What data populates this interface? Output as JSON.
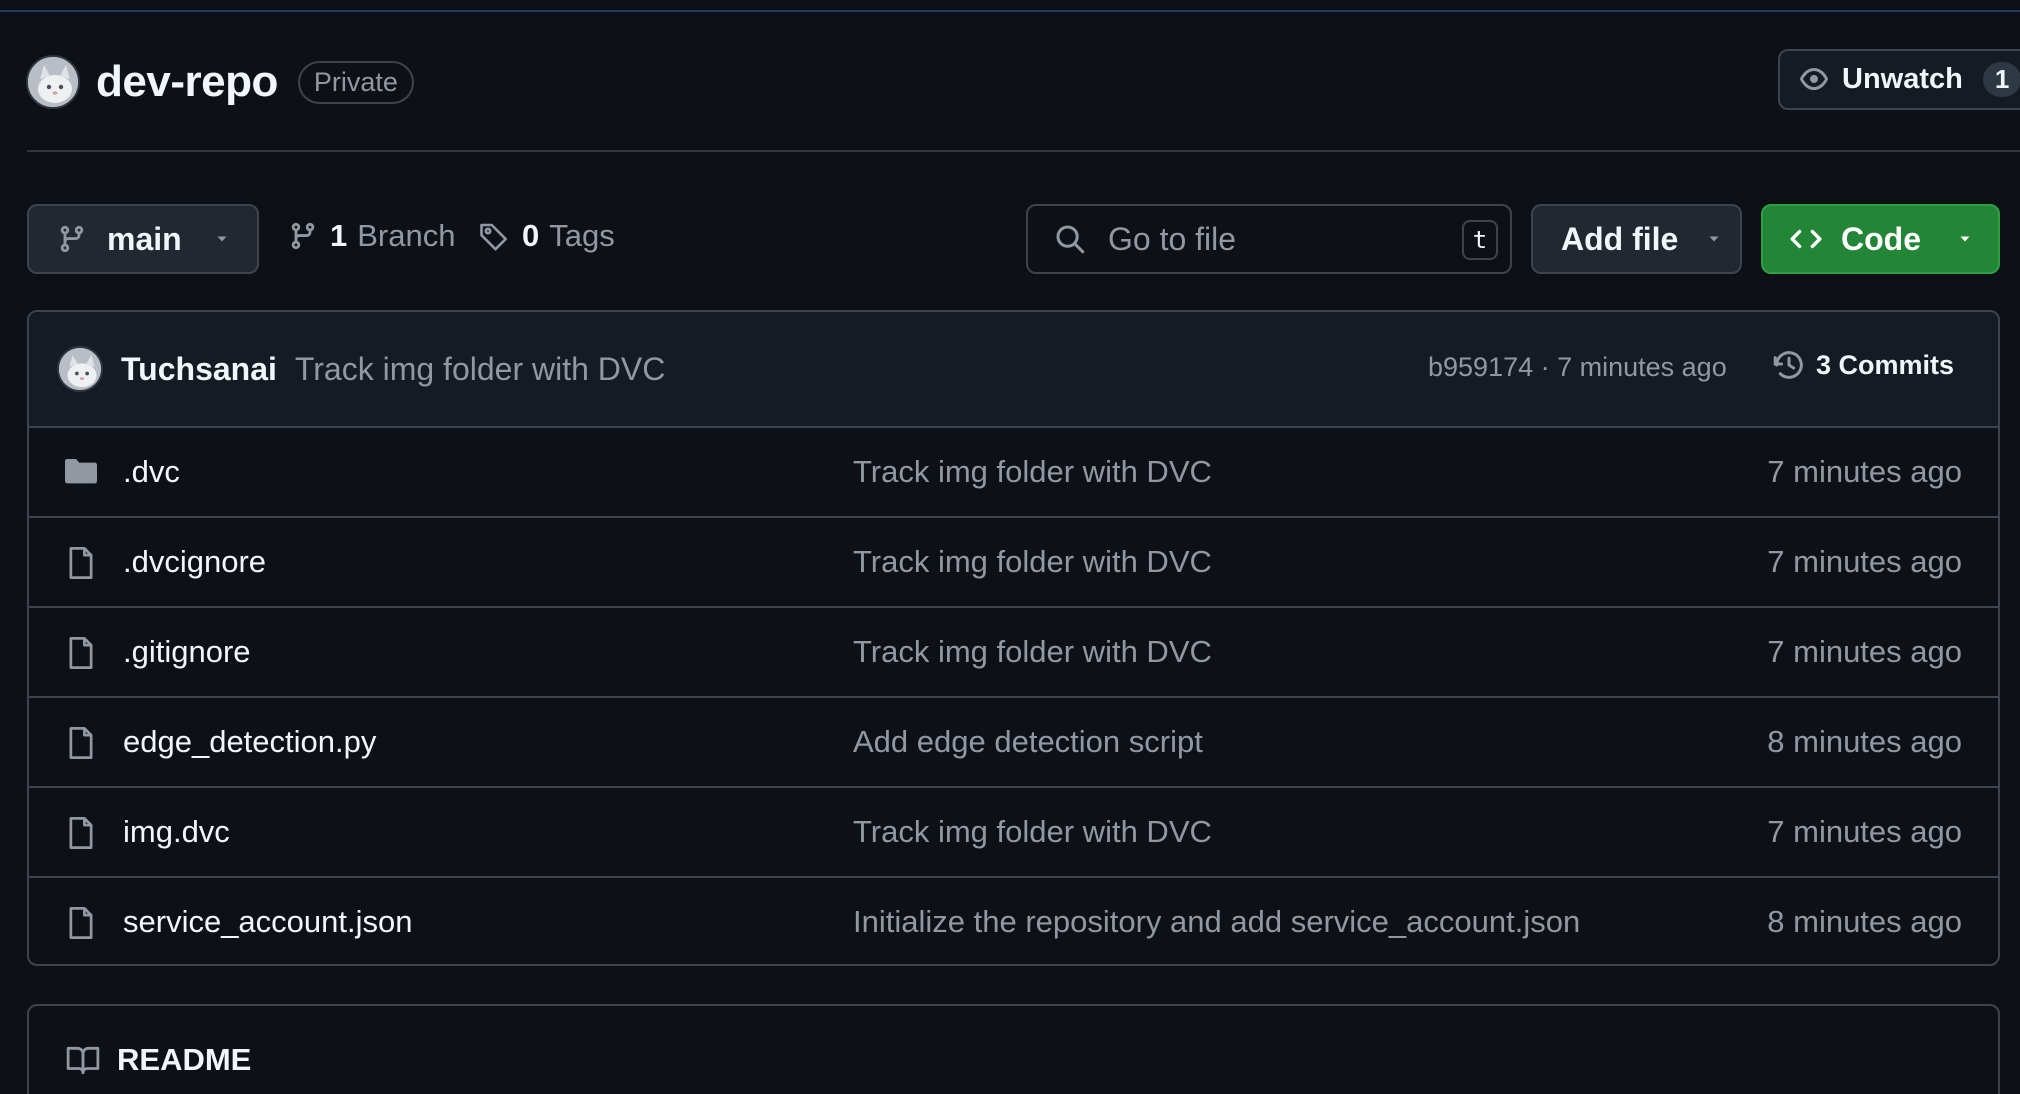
{
  "repo": {
    "name": "dev-repo",
    "visibility": "Private"
  },
  "watch": {
    "label": "Unwatch",
    "count": "1"
  },
  "toolbar": {
    "branch": "main",
    "branch_count": "1",
    "branch_label": "Branch",
    "tag_count": "0",
    "tag_label": "Tags",
    "search_placeholder": "Go to file",
    "search_shortcut": "t",
    "add_file_label": "Add file",
    "code_label": "Code"
  },
  "latest_commit": {
    "author": "Tuchsanai",
    "message": "Track img folder with DVC",
    "meta": "b959174 · 7 minutes ago",
    "commits_label": "3 Commits"
  },
  "files": [
    {
      "name": ".dvc",
      "type": "folder",
      "message": "Track img folder with DVC",
      "time": "7 minutes ago"
    },
    {
      "name": ".dvcignore",
      "type": "file",
      "message": "Track img folder with DVC",
      "time": "7 minutes ago"
    },
    {
      "name": ".gitignore",
      "type": "file",
      "message": "Track img folder with DVC",
      "time": "7 minutes ago"
    },
    {
      "name": "edge_detection.py",
      "type": "file",
      "message": "Add edge detection script",
      "time": "8 minutes ago"
    },
    {
      "name": "img.dvc",
      "type": "file",
      "message": "Track img folder with DVC",
      "time": "7 minutes ago"
    },
    {
      "name": "service_account.json",
      "type": "file",
      "message": "Initialize the repository and add service_account.json",
      "time": "8 minutes ago"
    }
  ],
  "readme": {
    "label": "README"
  },
  "icons": {
    "branch": "git-branch-icon",
    "tag": "tag-icon",
    "search": "search-icon",
    "eye": "eye-icon",
    "code": "code-icon",
    "history": "history-icon",
    "folder": "folder-icon",
    "file": "file-icon",
    "book": "book-icon"
  },
  "colors": {
    "background": "#0d1117",
    "primary_button": "#238636",
    "border": "#3d444d",
    "muted_text": "#9198a1"
  }
}
